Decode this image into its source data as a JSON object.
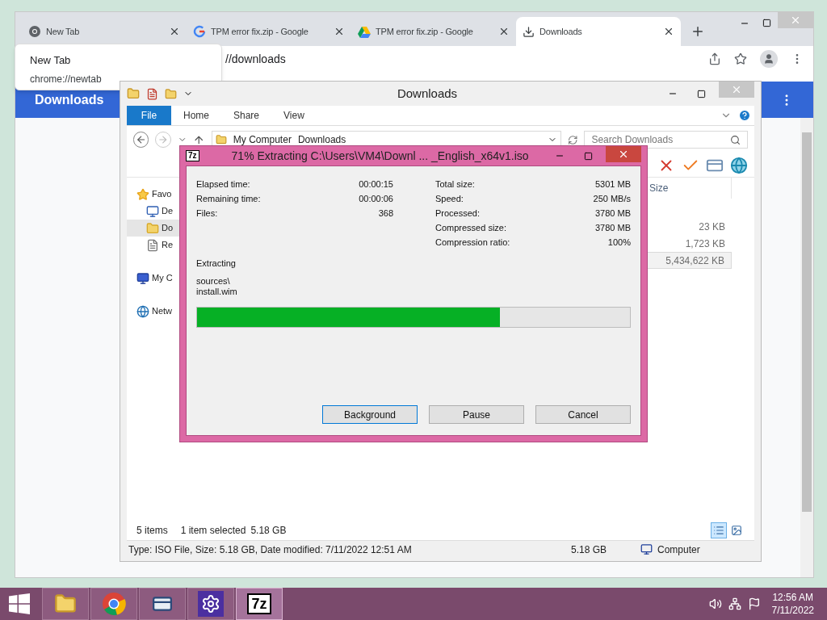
{
  "browser": {
    "tabs": [
      {
        "title": "New Tab",
        "kind": "chrome",
        "selected": false
      },
      {
        "title": "TPM error fix.zip - Google",
        "kind": "google",
        "selected": false
      },
      {
        "title": "TPM error fix.zip - Google",
        "kind": "drive",
        "selected": false
      },
      {
        "title": "Downloads",
        "kind": "download",
        "selected": true
      }
    ],
    "address": "//downloads",
    "page_title": "Downloads"
  },
  "tooltip": {
    "title": "New Tab",
    "url": "chrome://newtab"
  },
  "explorer": {
    "title": "Downloads",
    "ribbon": [
      {
        "label": "File",
        "kind": "file"
      },
      {
        "label": "Home",
        "kind": "tab"
      },
      {
        "label": "Share",
        "kind": "tab"
      },
      {
        "label": "View",
        "kind": "tab"
      }
    ],
    "breadcrumb": [
      "My Computer",
      "Downloads"
    ],
    "search": {
      "placeholder": "Search Downloads"
    },
    "nav": [
      {
        "label": "Favo",
        "kind": "star",
        "selected": false,
        "children": [
          {
            "label": "De",
            "kind": "desktop",
            "selected": false
          },
          {
            "label": "Do",
            "kind": "downloads",
            "selected": true
          },
          {
            "label": "Re",
            "kind": "recent",
            "selected": false
          }
        ]
      },
      {
        "label": "My C",
        "kind": "computer",
        "selected": false
      },
      {
        "label": "Netw",
        "kind": "network",
        "selected": false
      }
    ],
    "column": "Size",
    "rows": [
      {
        "size": "23 KB",
        "selected": false
      },
      {
        "size": "1,723 KB",
        "selected": false
      },
      {
        "size": "5,434,622 KB",
        "selected": true
      }
    ],
    "item_count": "5 items",
    "selection": "1 item selected",
    "selection_size": "5.18 GB",
    "views": [
      {
        "kind": "details",
        "selected": true
      },
      {
        "kind": "large",
        "selected": false
      }
    ],
    "details": "Type: ISO File, Size: 5.18 GB, Date modified: 7/11/2022 12:51 AM",
    "details_size": "5.18 GB",
    "location": "Computer"
  },
  "dialog": {
    "icon_label": "7z",
    "title": "71% Extracting C:\\Users\\VM4\\Downl ... _English_x64v1.iso",
    "left_stats": [
      {
        "label": "Elapsed time:",
        "value": "00:00:15"
      },
      {
        "label": "Remaining time:",
        "value": "00:00:06"
      },
      {
        "label": "Files:",
        "value": "368"
      }
    ],
    "right_stats": [
      {
        "label": "Total size:",
        "value": "5301 MB"
      },
      {
        "label": "Speed:",
        "value": "250 MB/s"
      },
      {
        "label": "Processed:",
        "value": "3780 MB"
      },
      {
        "label": "Compressed size:",
        "value": "3780 MB"
      },
      {
        "label": "Compression ratio:",
        "value": "100%"
      }
    ],
    "status": "Extracting",
    "path": [
      "sources\\",
      "install.wim"
    ],
    "level": 0.7,
    "buttons": [
      {
        "label": "Background",
        "focused": true
      },
      {
        "label": "Pause",
        "focused": false
      },
      {
        "label": "Cancel",
        "focused": false
      }
    ]
  },
  "taskbar": {
    "apps": [
      {
        "kind": "explorer",
        "selected": false
      },
      {
        "kind": "chrome",
        "selected": false
      },
      {
        "kind": "app",
        "selected": false
      },
      {
        "kind": "settings",
        "selected": false
      },
      {
        "kind": "sevenzip",
        "label": "7z",
        "selected": true
      }
    ],
    "time": "12:56 AM",
    "date": "7/11/2022"
  }
}
